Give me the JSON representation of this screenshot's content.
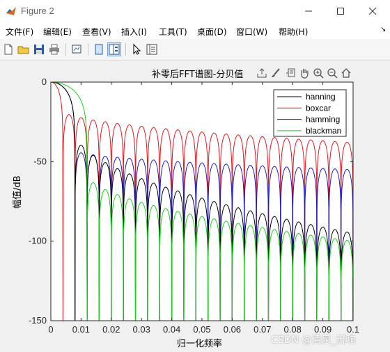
{
  "window": {
    "title": "Figure 2",
    "icon": "matlab-figure-icon"
  },
  "menu": {
    "items": [
      "文件(F)",
      "编辑(E)",
      "查看(V)",
      "插入(I)",
      "工具(T)",
      "桌面(D)",
      "窗口(W)",
      "帮助(H)"
    ]
  },
  "toolbar": {
    "buttons": [
      "new-figure-icon",
      "open-file-icon",
      "save-icon",
      "print-icon",
      "link-plot-icon",
      "hide-plot-tools-icon",
      "show-plot-tools-icon",
      "edit-plot-cursor-icon",
      "property-inspector-icon"
    ]
  },
  "axes_toolbar": {
    "buttons": [
      "export-icon",
      "brush-icon",
      "datatip-icon",
      "pan-icon",
      "zoom-in-icon",
      "zoom-out-icon",
      "home-icon"
    ]
  },
  "colors": {
    "hanning": "#000000",
    "boxcar": "#e8141c",
    "hamming": "#1a1acd",
    "blackman": "#17d117"
  },
  "watermark": "CSDN @清泉_流响",
  "chart_data": {
    "type": "line",
    "title": "补零后FFT谱图-分贝值",
    "xlabel": "归一化频率",
    "ylabel": "幅值/dB",
    "xlim": [
      0,
      0.1
    ],
    "ylim": [
      -150,
      0
    ],
    "xticks": [
      "0",
      "0.01",
      "0.02",
      "0.03",
      "0.04",
      "0.05",
      "0.06",
      "0.07",
      "0.08",
      "0.09",
      "0.1"
    ],
    "yticks": [
      "0",
      "-50",
      "-100",
      "-150"
    ],
    "grid": false,
    "legend_position": "top-right",
    "series": [
      {
        "name": "hanning",
        "mainlobe_null": 0.008,
        "lobe_spacing": 0.004,
        "peak_start": -32,
        "peak_end": -95
      },
      {
        "name": "boxcar",
        "mainlobe_null": 0.004,
        "lobe_spacing": 0.004,
        "peak_start": -18,
        "peak_end": -38
      },
      {
        "name": "hamming",
        "mainlobe_null": 0.008,
        "lobe_spacing": 0.004,
        "peak_start": -43,
        "peak_end": -55
      },
      {
        "name": "blackman",
        "mainlobe_null": 0.012,
        "lobe_spacing": 0.004,
        "peak_start": -58,
        "peak_end": -100
      }
    ]
  }
}
